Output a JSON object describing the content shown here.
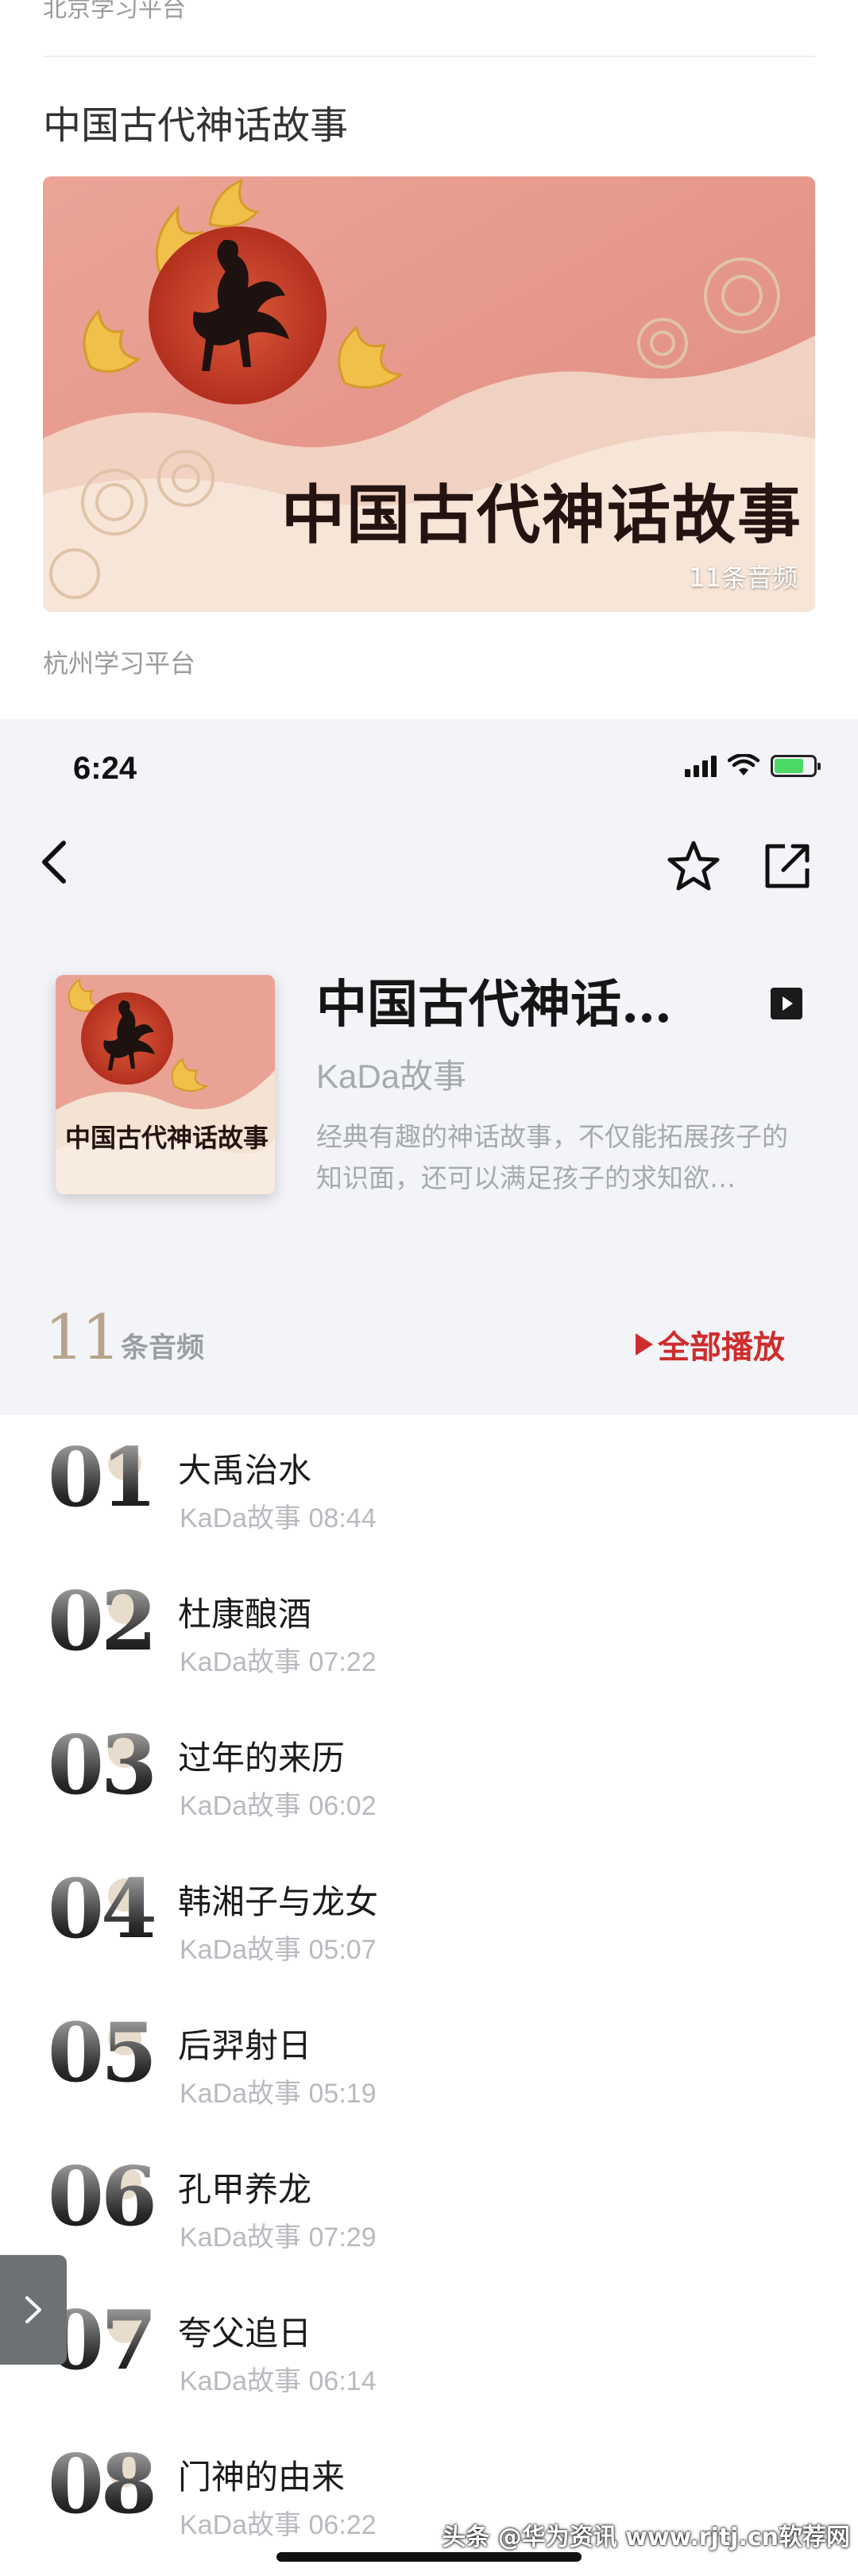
{
  "feed": {
    "prev_source": "北京学习平台",
    "title": "中国古代神话故事",
    "banner_title": "中国古代神话故事",
    "banner_count": "11条音频",
    "source": "杭州学习平台"
  },
  "status_bar": {
    "time": "6:24"
  },
  "album": {
    "cover_title": "中国古代神话故事",
    "title": "中国古代神话故事",
    "author": "KaDa故事",
    "description": "经典有趣的神话故事，不仅能拓展孩子的知识面，还可以满足孩子的求知欲…",
    "track_count": "11",
    "track_count_label": "条音频",
    "play_all_label": "全部播放"
  },
  "tracks": [
    {
      "number": "01",
      "title": "大禹治水",
      "author": "KaDa故事",
      "duration": "08:44"
    },
    {
      "number": "02",
      "title": "杜康酿酒",
      "author": "KaDa故事",
      "duration": "07:22"
    },
    {
      "number": "03",
      "title": "过年的来历",
      "author": "KaDa故事",
      "duration": "06:02"
    },
    {
      "number": "04",
      "title": "韩湘子与龙女",
      "author": "KaDa故事",
      "duration": "05:07"
    },
    {
      "number": "05",
      "title": "后羿射日",
      "author": "KaDa故事",
      "duration": "05:19"
    },
    {
      "number": "06",
      "title": "孔甲养龙",
      "author": "KaDa故事",
      "duration": "07:29"
    },
    {
      "number": "07",
      "title": "夸父追日",
      "author": "KaDa故事",
      "duration": "06:14"
    },
    {
      "number": "08",
      "title": "门神的由来",
      "author": "KaDa故事",
      "duration": "06:22"
    }
  ],
  "watermark": "头条 @华为资讯 www.rjtj.cn软荐网",
  "colors": {
    "accent_red": "#cd2d2d",
    "header_bg": "#f3f4f8",
    "count_gold": "#b8a48c",
    "banner_pink": "#e59a8e",
    "sun_red": "#c8412b"
  }
}
